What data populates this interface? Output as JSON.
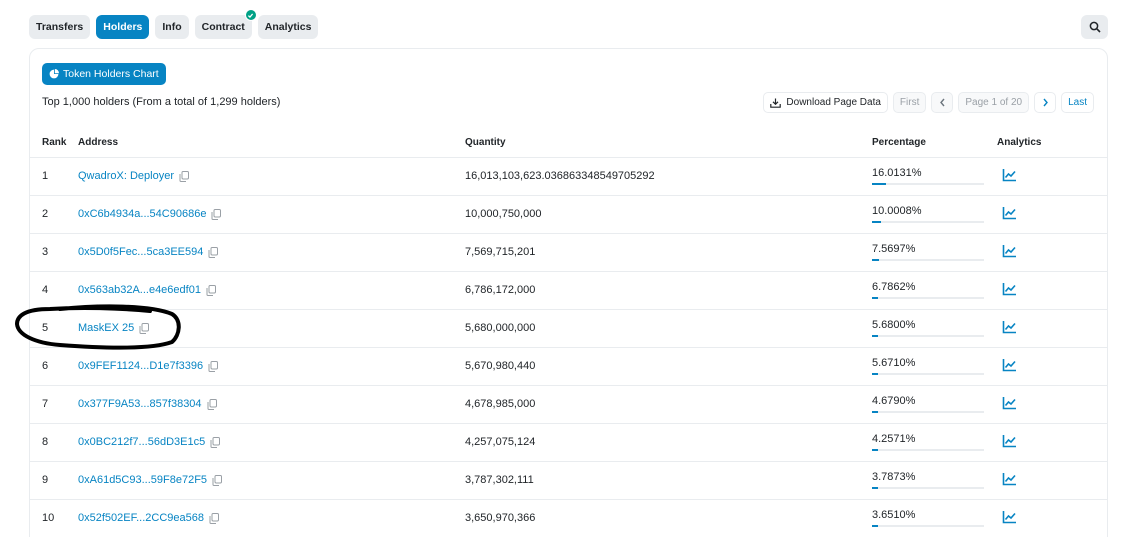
{
  "tabs": [
    {
      "label": "Transfers",
      "active": false
    },
    {
      "label": "Holders",
      "active": true
    },
    {
      "label": "Info",
      "active": false
    },
    {
      "label": "Contract",
      "active": false,
      "verified": true
    },
    {
      "label": "Analytics",
      "active": false
    }
  ],
  "chart_button": "Token Holders Chart",
  "summary": "Top 1,000 holders (From a total of 1,299 holders)",
  "pager": {
    "download": "Download Page Data",
    "first": "First",
    "page_info": "Page 1 of 20",
    "last": "Last"
  },
  "columns": {
    "rank": "Rank",
    "address": "Address",
    "quantity": "Quantity",
    "percentage": "Percentage",
    "analytics": "Analytics"
  },
  "holders": [
    {
      "rank": "1",
      "address": "QwadroX: Deployer",
      "quantity": "16,013,103,623.036863348549705292",
      "percentage": "16.0131%",
      "pct": 16.0131
    },
    {
      "rank": "2",
      "address": "0xC6b4934a...54C90686e",
      "quantity": "10,000,750,000",
      "percentage": "10.0008%",
      "pct": 10.0008
    },
    {
      "rank": "3",
      "address": "0x5D0f5Fec...5ca3EE594",
      "quantity": "7,569,715,201",
      "percentage": "7.5697%",
      "pct": 7.5697
    },
    {
      "rank": "4",
      "address": "0x563ab32A...e4e6edf01",
      "quantity": "6,786,172,000",
      "percentage": "6.7862%",
      "pct": 6.7862
    },
    {
      "rank": "5",
      "address": "MaskEX 25",
      "quantity": "5,680,000,000",
      "percentage": "5.6800%",
      "pct": 5.68
    },
    {
      "rank": "6",
      "address": "0x9FEF1124...D1e7f3396",
      "quantity": "5,670,980,440",
      "percentage": "5.6710%",
      "pct": 5.671
    },
    {
      "rank": "7",
      "address": "0x377F9A53...857f38304",
      "quantity": "4,678,985,000",
      "percentage": "4.6790%",
      "pct": 4.679
    },
    {
      "rank": "8",
      "address": "0x0BC212f7...56dD3E1c5",
      "quantity": "4,257,075,124",
      "percentage": "4.2571%",
      "pct": 4.2571
    },
    {
      "rank": "9",
      "address": "0xA61d5C93...59F8e72F5",
      "quantity": "3,787,302,111",
      "percentage": "3.7873%",
      "pct": 3.7873
    },
    {
      "rank": "10",
      "address": "0x52f502EF...2CC9ea568",
      "quantity": "3,650,970,366",
      "percentage": "3.6510%",
      "pct": 3.651
    }
  ],
  "colors": {
    "accent": "#0784c3",
    "verified": "#00a186",
    "annotation": "#000000"
  },
  "icons": {
    "search": "search-icon",
    "chart_button": "pie-chart-icon",
    "download": "download-icon",
    "copy": "copy-icon",
    "analytics": "line-chart-icon"
  }
}
